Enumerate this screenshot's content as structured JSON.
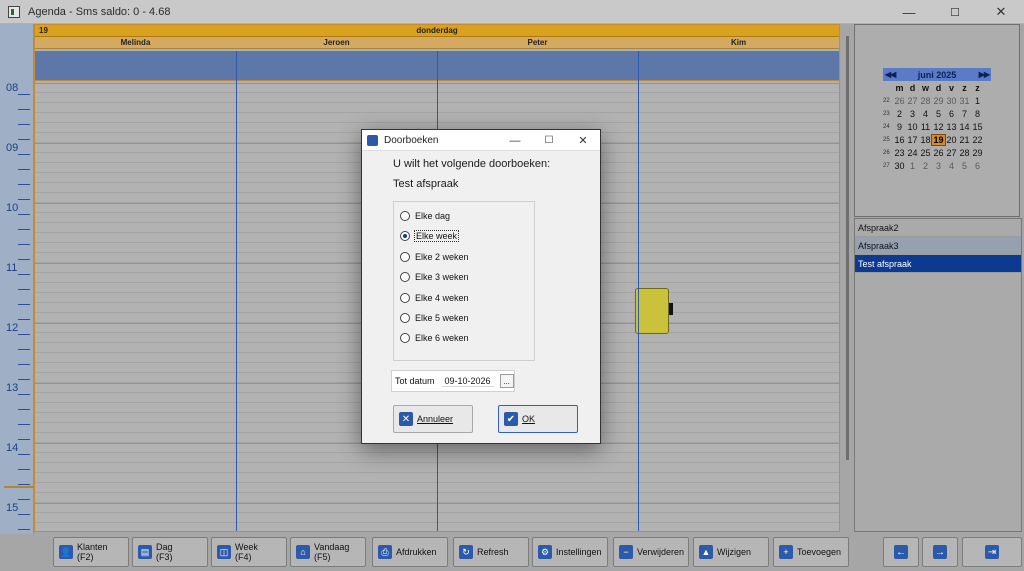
{
  "window": {
    "title": "Agenda - Sms saldo: 0 - 4.68",
    "minimize": "—",
    "maximize": "☐",
    "close": "✕"
  },
  "calendar": {
    "day_number": "19",
    "day_name": "donderdag",
    "persons": [
      "Melinda",
      "Jeroen",
      "Peter",
      "Kim"
    ],
    "hours": [
      "08",
      "09",
      "10",
      "11",
      "12",
      "13",
      "14",
      "15"
    ]
  },
  "mini_calendar": {
    "month_label": "juni 2025",
    "prev": "◀◀",
    "next": "▶▶",
    "weekdays": [
      "m",
      "d",
      "w",
      "d",
      "v",
      "z",
      "z"
    ],
    "weeks": [
      {
        "wk": "22",
        "days": [
          "26",
          "27",
          "28",
          "29",
          "30",
          "31",
          "1"
        ]
      },
      {
        "wk": "23",
        "days": [
          "2",
          "3",
          "4",
          "5",
          "6",
          "7",
          "8"
        ]
      },
      {
        "wk": "24",
        "days": [
          "9",
          "10",
          "11",
          "12",
          "13",
          "14",
          "15"
        ]
      },
      {
        "wk": "25",
        "days": [
          "16",
          "17",
          "18",
          "19",
          "20",
          "21",
          "22"
        ]
      },
      {
        "wk": "26",
        "days": [
          "23",
          "24",
          "25",
          "26",
          "27",
          "28",
          "29"
        ]
      },
      {
        "wk": "27",
        "days": [
          "30",
          "1",
          "2",
          "3",
          "4",
          "5",
          "6"
        ]
      }
    ],
    "today": "19"
  },
  "appointment_list": {
    "items": [
      "Afspraak2",
      "Afspraak3",
      "Test afspraak"
    ],
    "selected": "Test afspraak"
  },
  "toolbar": {
    "buttons": [
      {
        "label": "Klanten",
        "key": "(F2)",
        "icon": "user-icon",
        "glyph": "👤"
      },
      {
        "label": "Dag",
        "key": "(F3)",
        "icon": "day-icon",
        "glyph": "▤"
      },
      {
        "label": "Week",
        "key": "(F4)",
        "icon": "week-icon",
        "glyph": "◫"
      },
      {
        "label": "Vandaag",
        "key": "(F5)",
        "icon": "home-icon",
        "glyph": "⌂"
      },
      {
        "label": "Afdrukken",
        "key": "",
        "icon": "print-icon",
        "glyph": "⎙"
      },
      {
        "label": "Refresh",
        "key": "",
        "icon": "refresh-icon",
        "glyph": "↻"
      },
      {
        "label": "Instellingen",
        "key": "",
        "icon": "settings-icon",
        "glyph": "⚙"
      },
      {
        "label": "Verwijderen",
        "key": "",
        "icon": "minus-icon",
        "glyph": "−"
      },
      {
        "label": "Wijzigen",
        "key": "",
        "icon": "edit-icon",
        "glyph": "▲"
      },
      {
        "label": "Toevoegen",
        "key": "",
        "icon": "plus-icon",
        "glyph": "+"
      }
    ],
    "nav": {
      "prev": "←",
      "next": "→",
      "exit": "⇥"
    }
  },
  "dialog": {
    "title": "Doorboeken",
    "question": "U wilt het volgende doorboeken:",
    "subject": "Test afspraak",
    "options": [
      "Elke dag",
      "Elke week",
      "Elke 2 weken",
      "Elke 3 weken",
      "Elke 4 weken",
      "Elke 5 weken",
      "Elke 6 weken"
    ],
    "selected_option": "Elke week",
    "until_label": "Tot datum",
    "until_value": "09-10-2026",
    "picker": "...",
    "cancel_label": "Annuleer",
    "ok_label": "OK",
    "cancel_glyph": "✕",
    "ok_glyph": "✔",
    "minimize": "—",
    "maximize": "☐",
    "close": "✕"
  },
  "colors": {
    "accent": "#2c5aa8",
    "selection": "#0c3a90",
    "day_header": "#d9a21e",
    "appointment": "#c9c23a"
  }
}
